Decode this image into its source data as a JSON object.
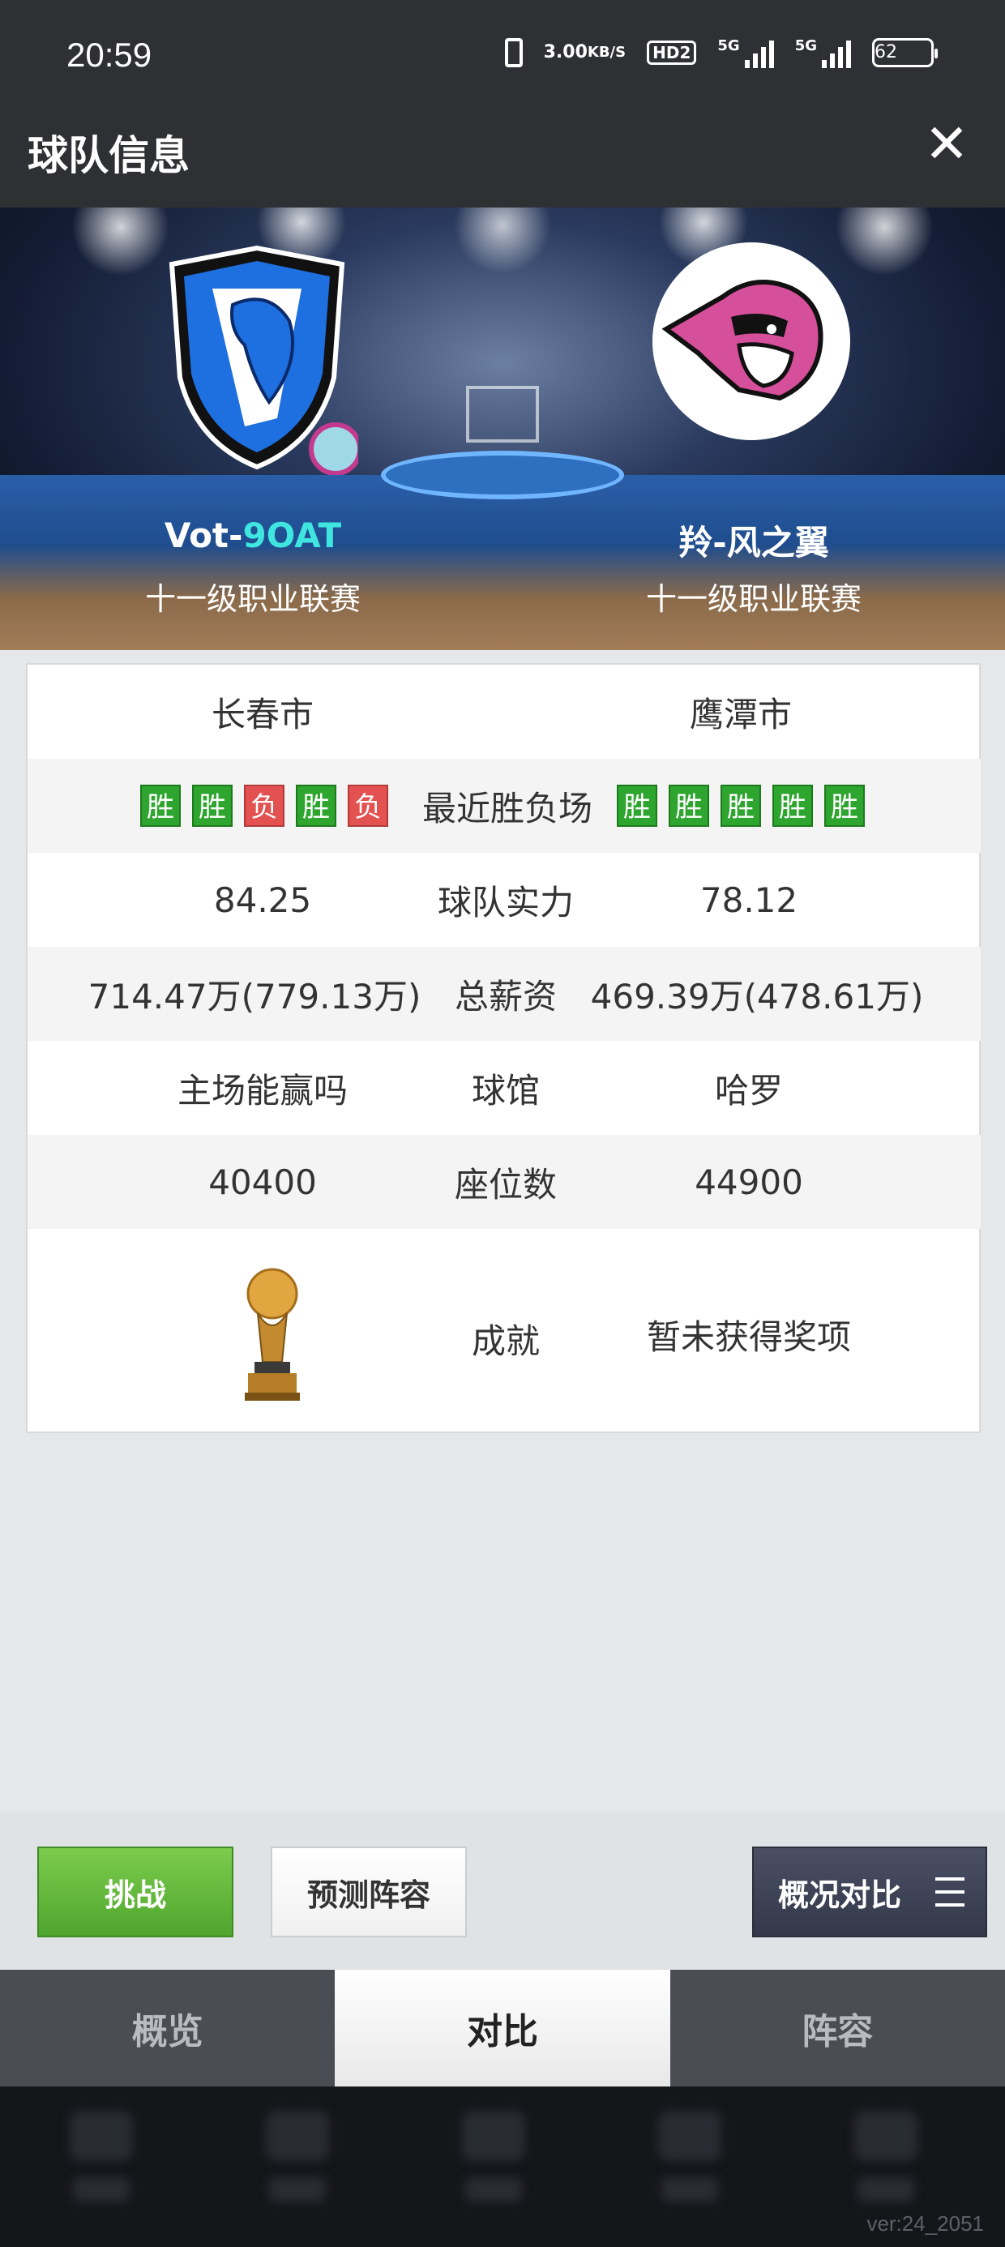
{
  "status_bar": {
    "time": "20:59",
    "speed_value": "3.00",
    "speed_unit": "KB/S",
    "hd": "HD2",
    "sim1": "5G",
    "sim2": "5G",
    "battery": "62"
  },
  "header": {
    "title": "球队信息",
    "close_icon": "close-icon"
  },
  "teams": {
    "left": {
      "name_prefix": "Vot-",
      "name_suffix": "9OAT",
      "league": "十一级职业联赛",
      "logo": "blue-dragon-shield-logo"
    },
    "right": {
      "name": "羚-风之翼",
      "league": "十一级职业联赛",
      "logo": "pink-gorilla-logo"
    }
  },
  "stats": {
    "city": {
      "left": "长春市",
      "right": "鹰潭市"
    },
    "recent": {
      "label": "最近胜负场",
      "left": [
        "胜",
        "胜",
        "负",
        "胜",
        "负"
      ],
      "right": [
        "胜",
        "胜",
        "胜",
        "胜",
        "胜"
      ]
    },
    "strength": {
      "label": "球队实力",
      "left": "84.25",
      "right": "78.12"
    },
    "salary": {
      "label": "总薪资",
      "left": "714.47万(779.13万)",
      "right": "469.39万(478.61万)"
    },
    "arena": {
      "label": "球馆",
      "left": "主场能赢吗",
      "right": "哈罗"
    },
    "seats": {
      "label": "座位数",
      "left": "40400",
      "right": "44900"
    },
    "achievement": {
      "label": "成就",
      "right": "暂未获得奖项",
      "icon": "trophy-icon"
    }
  },
  "buttons": {
    "challenge": "挑战",
    "predict": "预测阵容",
    "compare": "概况对比"
  },
  "tabs": [
    {
      "label": "概览",
      "active": false
    },
    {
      "label": "对比",
      "active": true
    },
    {
      "label": "阵容",
      "active": false
    }
  ],
  "version": "ver:24_2051",
  "colors": {
    "win": "#2ea52e",
    "loss": "#e35151",
    "accent_teal": "#3fe6e0",
    "header_bg": "#2f3033"
  }
}
